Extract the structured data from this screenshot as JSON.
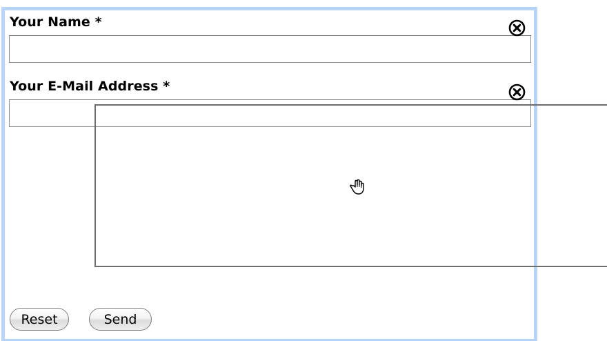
{
  "form": {
    "name_label": "Your Name *",
    "name_value": "",
    "email_label": "Your E-Mail Address *",
    "email_value": "",
    "reset_label": "Reset",
    "send_label": "Send"
  },
  "icons": {
    "clear_icon": "circle-x-icon",
    "cursor": "open-hand-cursor-icon"
  },
  "colors": {
    "frame": "#b7d3f7",
    "input_border": "#8f8f8f",
    "drag_outline": "#6d6d6d"
  }
}
